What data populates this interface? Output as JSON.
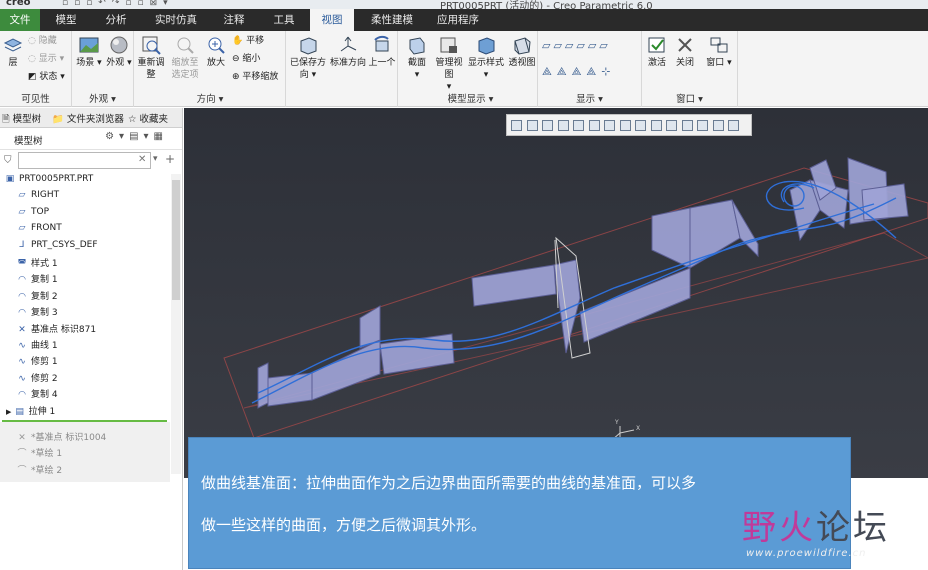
{
  "window": {
    "logo": "creo",
    "title": "PRT0005PRT (活动的) - Creo Parametric 6.0"
  },
  "menu": {
    "tabs": [
      "文件",
      "模型",
      "分析",
      "实时仿真",
      "注释",
      "工具",
      "视图",
      "柔性建模",
      "应用程序"
    ],
    "active": "视图"
  },
  "ribbon": {
    "groups": {
      "visibility": {
        "label": "可见性",
        "layer": "层",
        "hide": "隐藏",
        "show": "显示",
        "status": "状态"
      },
      "appearance": {
        "label": "外观",
        "scene": "场景",
        "appearance": "外观"
      },
      "orientation": {
        "label": "方向",
        "refit": "重新调整",
        "zoom_to_selected": "缩放至选定项",
        "zoom_in": "放大",
        "pan": "平移",
        "zoom_out": "缩小",
        "pan_zoom": "平移缩放",
        "saved_orientations": "已保存方向",
        "standard_orientation": "标准方向",
        "previous": "上一个"
      },
      "model_display": {
        "label": "模型显示",
        "section": "截面",
        "manage_views": "管理视图",
        "display_style": "显示样式",
        "perspective": "透视图"
      },
      "show": {
        "label": "显示"
      },
      "window": {
        "label": "窗口",
        "activate": "激活",
        "close": "关闭",
        "windows": "窗口"
      }
    }
  },
  "left_panel": {
    "tabs": [
      "模型树",
      "文件夹浏览器",
      "收藏夹"
    ],
    "header": "模型树",
    "filter_placeholder": "",
    "tree": [
      {
        "icon": "part-icon",
        "label": "PRT0005PRT.PRT"
      },
      {
        "icon": "datum-plane-icon",
        "label": "RIGHT"
      },
      {
        "icon": "datum-plane-icon",
        "label": "TOP"
      },
      {
        "icon": "datum-plane-icon",
        "label": "FRONT"
      },
      {
        "icon": "csys-icon",
        "label": "PRT_CSYS_DEF"
      },
      {
        "icon": "style-icon",
        "label": "样式 1"
      },
      {
        "icon": "copy-icon",
        "label": "复制 1"
      },
      {
        "icon": "copy-icon",
        "label": "复制 2"
      },
      {
        "icon": "copy-icon",
        "label": "复制 3"
      },
      {
        "icon": "datum-point-icon",
        "label": "基准点 标识871"
      },
      {
        "icon": "curve-icon",
        "label": "曲线 1"
      },
      {
        "icon": "trim-icon",
        "label": "修剪 1"
      },
      {
        "icon": "trim-icon",
        "label": "修剪 2"
      },
      {
        "icon": "copy-icon",
        "label": "复制 4"
      },
      {
        "icon": "extrude-icon",
        "label": "拉伸 1"
      },
      {
        "icon": "datum-point-icon",
        "label": "*基准点 标识1004"
      },
      {
        "icon": "sketch-icon",
        "label": "*草绘 1"
      },
      {
        "icon": "sketch-icon",
        "label": "*草绘 2"
      }
    ]
  },
  "annotation": {
    "line1": "做曲线基准面：拉伸曲面作为之后边界曲面所需要的曲线的基准面，可以多",
    "line2": "做一些这样的曲面，方便之后微调其外形。"
  },
  "watermark": {
    "text_a": "野火",
    "text_b": "论坛",
    "url": "www.proewildfire.cn"
  },
  "colors": {
    "file_tab": "#3d8b3d",
    "menubar": "#2a2a2a",
    "viewport": "#33363e",
    "surface": "#9ea3d6",
    "curve": "#2f6fd8",
    "note_bg": "#5b9bd5"
  }
}
